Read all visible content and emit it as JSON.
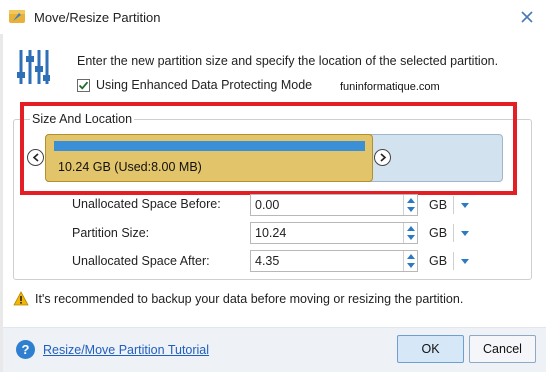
{
  "window": {
    "title": "Move/Resize Partition",
    "close_icon": "close-icon",
    "app_icon": "partition-wizard-icon"
  },
  "header": {
    "instruction": "Enter the new partition size and specify the location of the selected partition.",
    "checkbox_label": "Using Enhanced Data Protecting Mode",
    "checkbox_checked": true,
    "watermark": "funinformatique.com",
    "icon": "sliders-icon"
  },
  "size_location": {
    "title": "Size And Location",
    "partition_label": "10.24 GB (Used:8.00 MB)",
    "colors": {
      "partition": "#e2c46a",
      "used": "#3a8fd6",
      "unallocated": "#d2e2ee",
      "highlight": "#e31e24"
    }
  },
  "fields": [
    {
      "label": "Unallocated Space Before:",
      "value": "0.00",
      "unit": "GB"
    },
    {
      "label": "Partition Size:",
      "value": "10.24",
      "unit": "GB"
    },
    {
      "label": "Unallocated Space After:",
      "value": "4.35",
      "unit": "GB"
    }
  ],
  "warning": {
    "icon": "warning-icon",
    "text": "It's recommended to backup your data before moving or resizing the partition."
  },
  "footer": {
    "help_icon": "help-icon",
    "tutorial_link": "Resize/Move Partition Tutorial",
    "ok_label": "OK",
    "cancel_label": "Cancel"
  }
}
